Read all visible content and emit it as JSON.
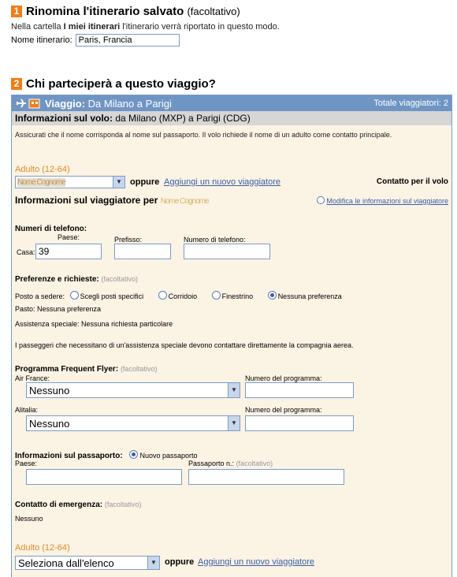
{
  "step1": {
    "number": "1",
    "title": "Rinomina l'itinerario salvato",
    "optional": "(facoltativo)",
    "desc_pre": "Nella cartella ",
    "desc_bold": "I miei itinerari",
    "desc_post": " l'itinerario verrà riportato in questo modo.",
    "name_label": "Nome itinerario:",
    "name_value": "Paris, Francia"
  },
  "step2": {
    "number": "2",
    "title": "Chi parteciperà a questo viaggio?"
  },
  "panel": {
    "title": "Viaggio:",
    "dest": "Da Milano a Parigi",
    "total": "Totale viaggiatori: 2",
    "flight_info_label": "Informazioni sul volo:",
    "flight_info_value": "da Milano (MXP) a Parigi (CDG)",
    "notice": "Assicurati che il nome corrisponda al nome sul passaporto. Il volo richiede il nome di un adulto come contatto principale."
  },
  "traveler1": {
    "type": "Adulto (12-64)",
    "select_value": "Nome Cognome",
    "oppure": "oppure",
    "add_link": "Aggiungi un nuovo viaggiatore",
    "contact": "Contatto per il volo",
    "info_title": "Informazioni sul viaggiatore per",
    "info_name": "Nome Cognome",
    "edit_link": "Modifica le informazioni sul viaggiatore",
    "phones_title": "Numeri di telefono:",
    "col_country": "Paese:",
    "col_prefix": "Prefisso:",
    "col_number": "Numero di telefono:",
    "row_label": "Casa:",
    "country_code": "39",
    "prefs_title": "Preferenze e richieste:",
    "prefs_optional": "(facoltativo)",
    "seat_label": "Posto a sedere:",
    "seat_options": [
      "Scegli posti specifici",
      "Corridoio",
      "Finestrino",
      "Nessuna preferenza"
    ],
    "meal": "Pasto: Nessuna preferenza",
    "assistance": "Assistenza speciale: Nessuna richiesta particolare",
    "assist_note": "I passeggeri che necessitano di un'assistenza speciale devono contattare direttamente la compagnia aerea.",
    "ff_title": "Programma Frequent Flyer:",
    "ff_optional": "(facoltativo)",
    "ff_airfrance": "Air France:",
    "ff_alitalia": "Alitalia:",
    "ff_value": "Nessuno",
    "ff_number_label": "Numero del programma:",
    "passport_title": "Informazioni sul passaporto:",
    "passport_new": "Nuovo passaporto",
    "passport_country": "Paese:",
    "passport_number": "Passaporto n.:",
    "passport_optional": "(facoltativo)",
    "emergency_title": "Contatto di emergenza:",
    "emergency_optional": "(facoltativo)",
    "emergency_value": "Nessuno"
  },
  "traveler2": {
    "type": "Adulto (12-64)",
    "select_value": "Seleziona dall'elenco",
    "oppure": "oppure",
    "add_link": "Aggiungi un nuovo viaggiatore"
  },
  "colors": {
    "accent": "#f07d1a",
    "panel_header": "#6f95c5",
    "panel_bg": "#fbf3e4",
    "link": "#3a5ea8"
  }
}
